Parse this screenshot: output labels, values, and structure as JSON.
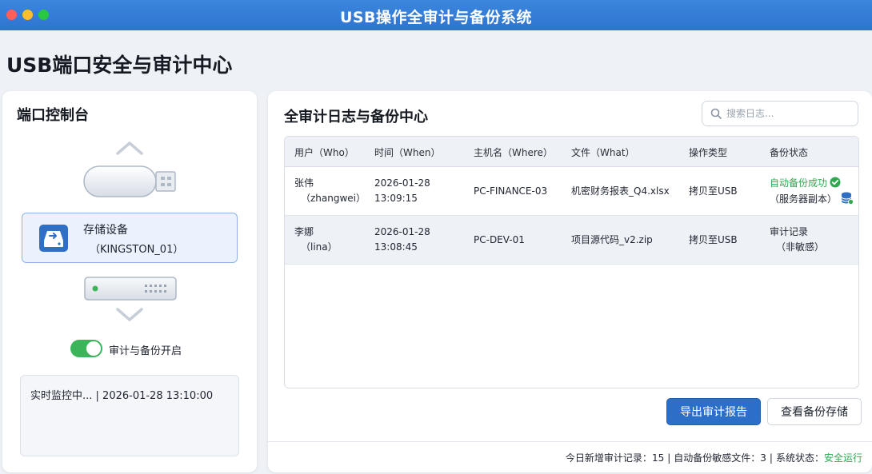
{
  "window": {
    "title": "USB操作全审计与备份系统"
  },
  "page": {
    "title": "USB端口安全与审计中心"
  },
  "console": {
    "heading": "端口控制台",
    "device": {
      "name": "存储设备",
      "id": "（KINGSTON_01）"
    },
    "toggle": {
      "label": "审计与备份开启",
      "on": true
    },
    "monitor_text": "实时监控中... | 2026-01-28 13:10:00"
  },
  "audit": {
    "heading": "全审计日志与备份中心",
    "search": {
      "placeholder": "搜索日志...",
      "value": ""
    },
    "columns": [
      "用户（Who）",
      "时间（When）",
      "主机名（Where）",
      "文件（What）",
      "操作类型",
      "备份状态"
    ],
    "rows": [
      {
        "user": "张伟",
        "user_id": "（zhangwei）",
        "date": "2026-01-28",
        "time": "13:09:15",
        "host": "PC-FINANCE-03",
        "file": "机密财务报表_Q4.xlsx",
        "op": "拷贝至USB",
        "status": "自动备份成功",
        "status_detail": "（服务器副本）"
      },
      {
        "user": "李娜",
        "user_id": "（lina）",
        "date": "2026-01-28",
        "time": "13:08:45",
        "host": "PC-DEV-01",
        "file": "项目源代码_v2.zip",
        "op": "拷贝至USB",
        "status": "审计记录",
        "status_detail": "（非敏感）"
      }
    ],
    "buttons": {
      "export": "导出审计报告",
      "view_backup": "查看备份存储"
    },
    "stats": {
      "new_records_label": "今日新增审计记录：",
      "new_records": "15",
      "auto_backup_label": "自动备份敏感文件：",
      "auto_backup": "3",
      "system_label": "系统状态：",
      "system_status": "安全运行"
    }
  },
  "colors": {
    "titlebar": "#2f74cf",
    "accent": "#2c6fc9",
    "success": "#2fa84f",
    "toggle_on": "#3cb55a"
  }
}
